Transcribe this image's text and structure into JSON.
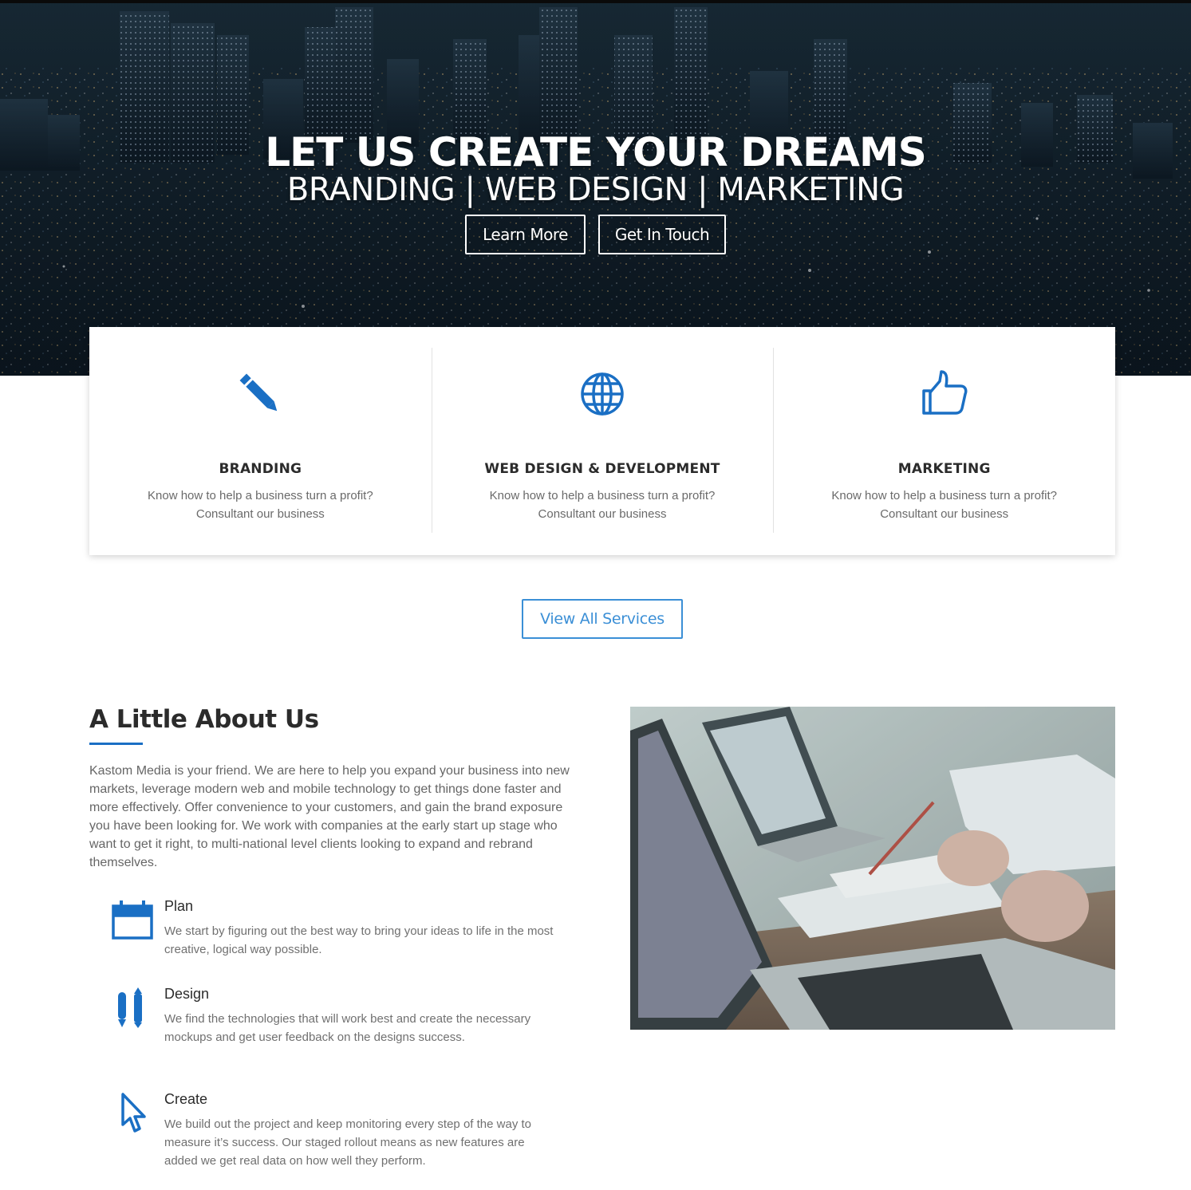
{
  "hero": {
    "title": "LET US CREATE YOUR DREAMS",
    "subtitle": "BRANDING | WEB DESIGN | MARKETING",
    "learn_more": "Learn More",
    "get_in_touch": "Get In Touch"
  },
  "services": [
    {
      "icon": "pencil-icon",
      "title": "BRANDING",
      "desc_line1": "Know how to help a business turn a profit?",
      "desc_line2": "Consultant our business"
    },
    {
      "icon": "globe-icon",
      "title": "WEB DESIGN & DEVELOPMENT",
      "desc_line1": "Know how to help a business turn a profit?",
      "desc_line2": "Consultant our business"
    },
    {
      "icon": "thumbs-up-icon",
      "title": "MARKETING",
      "desc_line1": "Know how to help a business turn a profit?",
      "desc_line2": "Consultant our business"
    }
  ],
  "view_all": "View All Services",
  "about": {
    "title": "A Little About Us",
    "text": "Kastom Media is your friend. We are here to help you expand your business into new markets, leverage modern web and mobile technology to get things done faster and more effectively. Offer convenience to your customers, and gain the brand exposure you have been looking for. We work with companies at the early start up stage who want to get it right, to multi-national level clients looking to expand and rebrand themselves.",
    "steps": [
      {
        "icon": "calendar-icon",
        "title": "Plan",
        "desc": "We start by figuring out the best way to bring your ideas to life in the most creative, logical way possible."
      },
      {
        "icon": "pens-icon",
        "title": "Design",
        "desc": "We find the technologies that will work best and create the necessary mockups and get user feedback on the designs success."
      },
      {
        "icon": "cursor-icon",
        "title": "Create",
        "desc": "We build out the project and keep monitoring every step of the way to measure it’s success. Our staged rollout means as new features are added we get real data on how well they perform."
      }
    ]
  },
  "colors": {
    "accent": "#1a6fc4",
    "button_outline": "#3b8fd6"
  }
}
